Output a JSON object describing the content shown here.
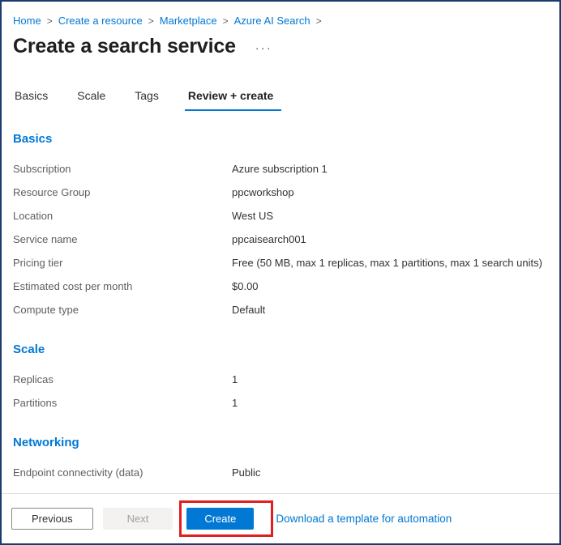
{
  "breadcrumb": {
    "separator": ">",
    "items": [
      {
        "label": "Home"
      },
      {
        "label": "Create a resource"
      },
      {
        "label": "Marketplace"
      },
      {
        "label": "Azure AI Search"
      }
    ]
  },
  "header": {
    "title": "Create a search service",
    "more_options": "···"
  },
  "tabs": [
    {
      "label": "Basics"
    },
    {
      "label": "Scale"
    },
    {
      "label": "Tags"
    },
    {
      "label": "Review + create"
    }
  ],
  "sections": [
    {
      "heading": "Basics",
      "rows": [
        {
          "label": "Subscription",
          "value": "Azure subscription 1"
        },
        {
          "label": "Resource Group",
          "value": "ppcworkshop"
        },
        {
          "label": "Location",
          "value": "West US"
        },
        {
          "label": "Service name",
          "value": "ppcaisearch001"
        },
        {
          "label": "Pricing tier",
          "value": "Free (50 MB, max 1 replicas, max 1 partitions, max 1 search units)"
        },
        {
          "label": "Estimated cost per month",
          "value": "$0.00"
        },
        {
          "label": "Compute type",
          "value": "Default"
        }
      ]
    },
    {
      "heading": "Scale",
      "rows": [
        {
          "label": "Replicas",
          "value": "1"
        },
        {
          "label": "Partitions",
          "value": "1"
        }
      ]
    },
    {
      "heading": "Networking",
      "rows": [
        {
          "label": "Endpoint connectivity (data)",
          "value": "Public"
        }
      ]
    }
  ],
  "footer": {
    "previous_label": "Previous",
    "next_label": "Next",
    "create_label": "Create",
    "template_link_label": "Download a template for automation"
  },
  "colors": {
    "accent": "#0078d4",
    "annotation_red": "#e02020",
    "outer_border": "#1e3a6e"
  }
}
